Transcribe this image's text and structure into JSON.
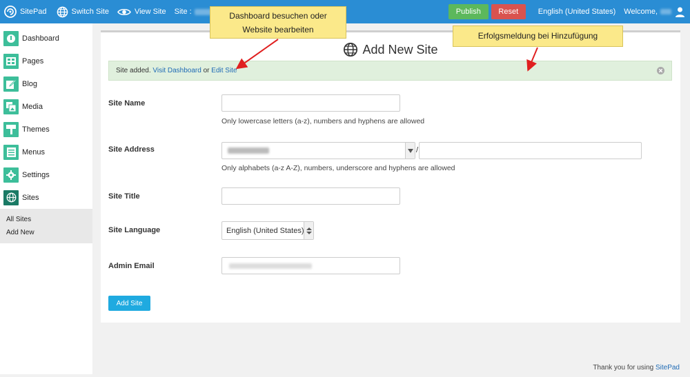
{
  "topbar": {
    "logo_label": "SitePad",
    "switch_site_label": "Switch Site",
    "view_site_label": "View Site",
    "site_label": "Site :",
    "publish_label": "Publish",
    "reset_label": "Reset",
    "language_label": "English (United States)",
    "welcome_label": "Welcome,"
  },
  "sidebar": {
    "items": [
      {
        "label": "Dashboard",
        "icon": "dashboard-icon"
      },
      {
        "label": "Pages",
        "icon": "pages-icon"
      },
      {
        "label": "Blog",
        "icon": "blog-icon"
      },
      {
        "label": "Media",
        "icon": "media-icon"
      },
      {
        "label": "Themes",
        "icon": "themes-icon"
      },
      {
        "label": "Menus",
        "icon": "menus-icon"
      },
      {
        "label": "Settings",
        "icon": "settings-icon"
      },
      {
        "label": "Sites",
        "icon": "globe-icon"
      }
    ],
    "submenu": [
      {
        "label": "All Sites"
      },
      {
        "label": "Add New"
      }
    ]
  },
  "main": {
    "title": "Add New Site",
    "notice": {
      "prefix": "Site added.",
      "link1": "Visit Dashboard",
      "middle": "or",
      "link2": "Edit Site"
    },
    "form": {
      "site_name_label": "Site Name",
      "site_name_value": "",
      "site_name_help": "Only lowercase letters (a-z), numbers and hyphens are allowed",
      "site_address_label": "Site Address",
      "site_address_separator": "/",
      "site_address_path_value": "",
      "site_address_help": "Only alphabets (a-z A-Z), numbers, underscore and hyphens are allowed",
      "site_title_label": "Site Title",
      "site_title_value": "",
      "site_language_label": "Site Language",
      "site_language_value": "English (United States)",
      "admin_email_label": "Admin Email",
      "submit_label": "Add Site"
    }
  },
  "footer": {
    "text": "Thank you for using",
    "link": "SitePad"
  },
  "callouts": {
    "left_line1": "Dashboard besuchen oder",
    "left_line2": "Website bearbeiten",
    "right": "Erfolgsmeldung bei Hinzufügung"
  },
  "colors": {
    "topbar": "#2a8dd4",
    "sidebar_icon": "#3dbe9a",
    "publish": "#5cb85c",
    "reset": "#d9534f",
    "submit": "#1faae0",
    "callout": "#fbe98a",
    "arrow": "#e02020"
  }
}
